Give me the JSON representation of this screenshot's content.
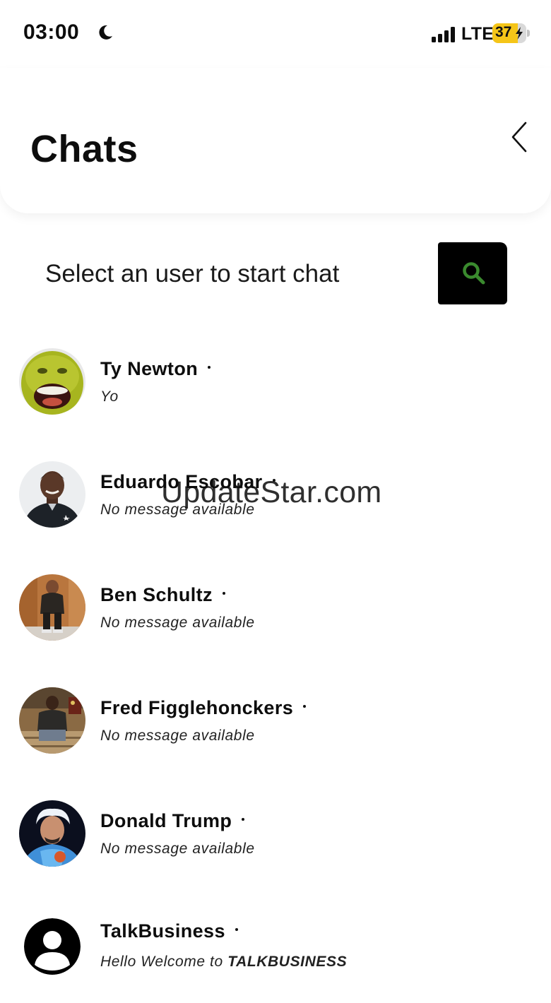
{
  "status_bar": {
    "time": "03:00",
    "network": "LTE",
    "battery_level": "37",
    "battery_fraction": 0.37,
    "icons": [
      "moon-icon",
      "signal-icon",
      "battery-icon",
      "charging-bolt-icon"
    ]
  },
  "header": {
    "title": "Chats",
    "back_icon": "chevron-left-icon"
  },
  "search": {
    "prompt": "Select an user to start chat",
    "icon": "search-icon",
    "icon_color": "#3a8a2e"
  },
  "chats": [
    {
      "name": "Ty Newton",
      "preview": "Yo",
      "avatar": "green-cartoon-face"
    },
    {
      "name": "Eduardo Escobar",
      "preview": "No message available",
      "avatar": "photo"
    },
    {
      "name": "Ben Schultz",
      "preview": "No message available",
      "avatar": "photo"
    },
    {
      "name": "Fred Figglehonckers",
      "preview": "No message available",
      "avatar": "photo"
    },
    {
      "name": "Donald Trump",
      "preview": "No message available",
      "avatar": "photo"
    },
    {
      "name": "TalkBusiness",
      "preview_prefix": "Hello Welcome to ",
      "preview_bold": "TALKBUSINESS",
      "avatar": "default-user-icon"
    }
  ],
  "watermark": "UpdateStar.com",
  "colors": {
    "background": "#ffffff",
    "search_button": "#000000",
    "battery_fill": "#f5c518"
  }
}
